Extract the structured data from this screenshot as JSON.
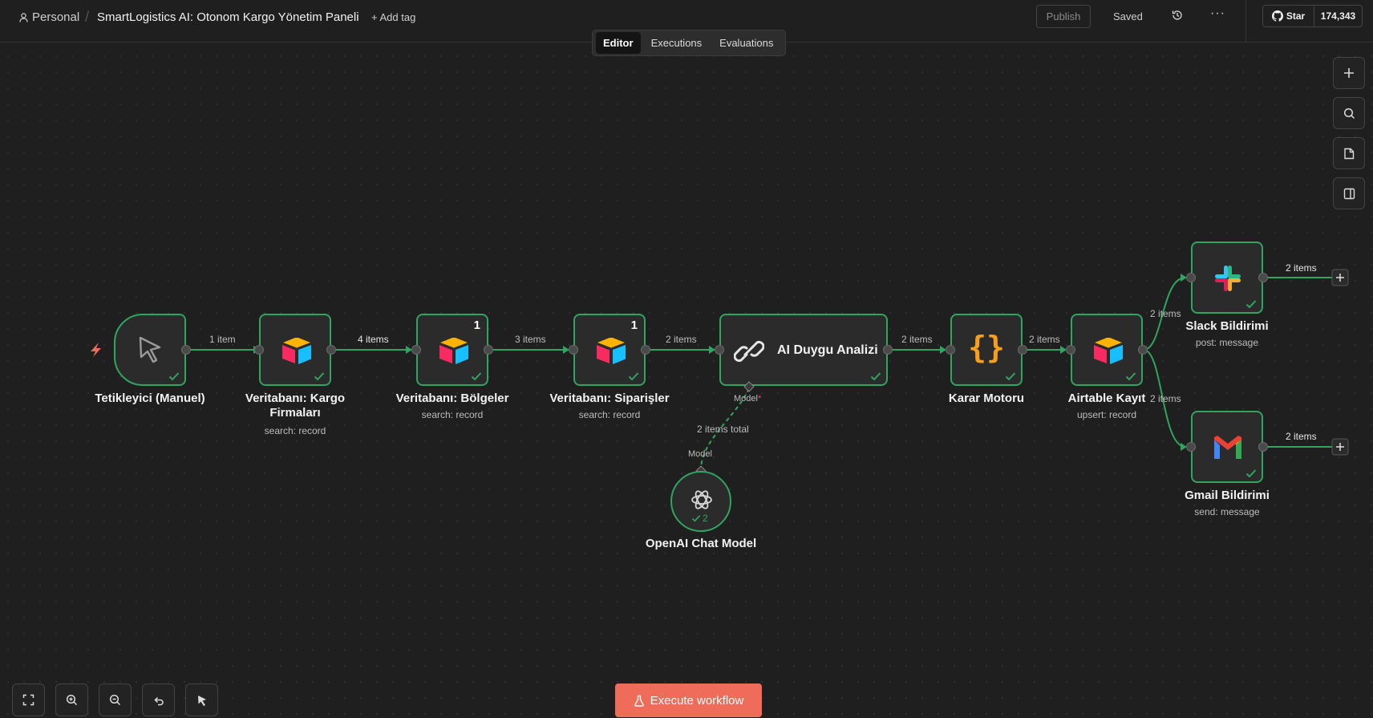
{
  "header": {
    "personal_label": "Personal",
    "workflow_title": "SmartLogistics AI: Otonom Kargo Yönetim Paneli",
    "add_tag_label": "+ Add tag",
    "publish_label": "Publish",
    "saved_label": "Saved",
    "github": {
      "star_label": "Star",
      "star_count": "174,343"
    }
  },
  "tabs": [
    {
      "label": "Editor",
      "active": true
    },
    {
      "label": "Executions",
      "active": false
    },
    {
      "label": "Evaluations",
      "active": false
    }
  ],
  "nodes": [
    {
      "id": "trigger",
      "label": "Tetikleyici (Manuel)",
      "subtitle": "",
      "icon": "cursor-icon",
      "badge": ""
    },
    {
      "id": "kargo",
      "label": "Veritabanı: Kargo Firmaları",
      "subtitle": "search: record",
      "icon": "airtable-icon",
      "badge": ""
    },
    {
      "id": "bolgeler",
      "label": "Veritabanı: Bölgeler",
      "subtitle": "search: record",
      "icon": "airtable-icon",
      "badge": "1"
    },
    {
      "id": "siparisler",
      "label": "Veritabanı: Siparişler",
      "subtitle": "search: record",
      "icon": "airtable-icon",
      "badge": "1"
    },
    {
      "id": "ai",
      "label": "AI Duygu Analizi",
      "subtitle": "",
      "icon": "link-icon",
      "badge": ""
    },
    {
      "id": "karar",
      "label": "Karar Motoru",
      "subtitle": "",
      "icon": "code-braces-icon",
      "badge": ""
    },
    {
      "id": "airtable",
      "label": "Airtable Kayıt",
      "subtitle": "upsert: record",
      "icon": "airtable-icon",
      "badge": ""
    },
    {
      "id": "slack",
      "label": "Slack Bildirimi",
      "subtitle": "post: message",
      "icon": "slack-icon",
      "badge": ""
    },
    {
      "id": "gmail",
      "label": "Gmail Bildirimi",
      "subtitle": "send: message",
      "icon": "gmail-icon",
      "badge": ""
    },
    {
      "id": "openai",
      "label": "OpenAI Chat Model",
      "subtitle": "",
      "icon": "openai-icon",
      "badge": "2"
    }
  ],
  "edges": {
    "trigger_kargo": "1 item",
    "kargo_bolgeler": "4 items",
    "bolgeler_siparisler": "3 items",
    "siparisler_ai": "2 items",
    "ai_karar": "2 items",
    "karar_airtable": "2 items",
    "airtable_slack": "2 items",
    "airtable_gmail": "2 items",
    "slack_out": "2 items",
    "gmail_out": "2 items",
    "model_input_label": "Model",
    "model_required_mark": "*",
    "model_total": "2 items total",
    "model_output_label": "Model"
  },
  "footer": {
    "execute_label": "Execute workflow"
  },
  "colors": {
    "success": "#2fa561",
    "execute": "#ef6b5a",
    "canvas": "#1f1f1f"
  }
}
